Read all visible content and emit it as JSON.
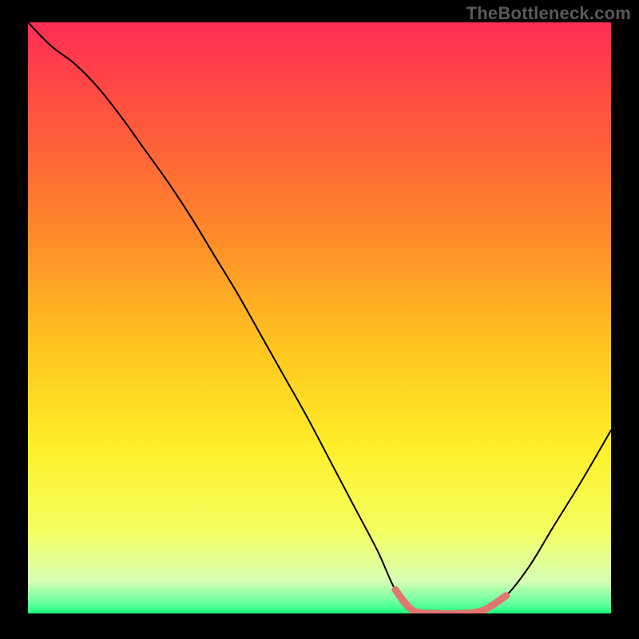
{
  "watermark": "TheBottleneck.com",
  "chart_data": {
    "type": "line",
    "title": "",
    "xlabel": "",
    "ylabel": "",
    "xlim": [
      0,
      100
    ],
    "ylim": [
      0,
      100
    ],
    "grid": false,
    "legend": false,
    "series": [
      {
        "name": "curve",
        "color": "#000000",
        "x": [
          0,
          4,
          8,
          12,
          16,
          20,
          24,
          28,
          32,
          36,
          40,
          44,
          48,
          52,
          56,
          60,
          63,
          66,
          70,
          74,
          78,
          82,
          86,
          90,
          95,
          100
        ],
        "values": [
          100,
          96,
          93,
          89,
          84,
          78.5,
          73,
          67,
          60.5,
          54,
          47,
          40,
          33,
          25.5,
          18,
          10.5,
          4,
          0.5,
          0,
          0,
          0.5,
          3,
          8,
          14.5,
          22.5,
          31
        ]
      },
      {
        "name": "highlight",
        "color": "#e0766f",
        "x": [
          63,
          66,
          70,
          74,
          78,
          82
        ],
        "values": [
          4,
          0.5,
          0,
          0,
          0.5,
          3
        ]
      }
    ],
    "gradient_stops": [
      {
        "offset": 0.0,
        "color": "#ff2d55"
      },
      {
        "offset": 0.18,
        "color": "#ff5a3c"
      },
      {
        "offset": 0.36,
        "color": "#ff8a2a"
      },
      {
        "offset": 0.55,
        "color": "#ffc51f"
      },
      {
        "offset": 0.72,
        "color": "#ffef2a"
      },
      {
        "offset": 0.86,
        "color": "#f4ff60"
      },
      {
        "offset": 0.945,
        "color": "#d7ffb4"
      },
      {
        "offset": 0.985,
        "color": "#5dff9e"
      },
      {
        "offset": 1.0,
        "color": "#1aff7a"
      }
    ]
  }
}
